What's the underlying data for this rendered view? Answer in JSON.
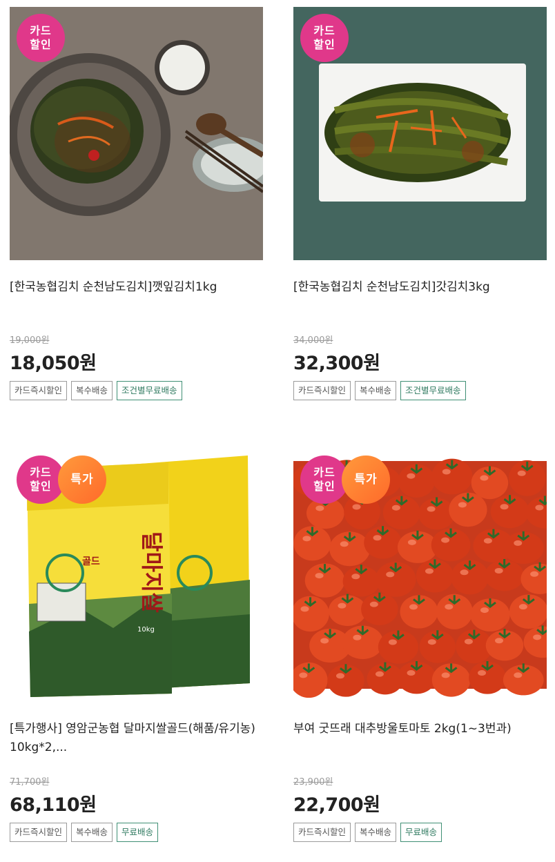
{
  "products": [
    {
      "title": "[한국농협김치 순천남도김치]깻잎김치1kg",
      "orig_price": "19,000원",
      "price": "18,050원",
      "badges": {
        "card": "카드\n할인"
      },
      "tags": [
        "카드즉시할인",
        "복수배송",
        "조건별무료배송"
      ],
      "tag_green_index": 2
    },
    {
      "title": "[한국농협김치 순천남도김치]갓김치3kg",
      "orig_price": "34,000원",
      "price": "32,300원",
      "badges": {
        "card": "카드\n할인"
      },
      "tags": [
        "카드즉시할인",
        "복수배송",
        "조건별무료배송"
      ],
      "tag_green_index": 2
    },
    {
      "title": "[특가행사] 영암군농협 달마지쌀골드(해품/유기농) 10kg*2,...",
      "orig_price": "71,700원",
      "price": "68,110원",
      "badges": {
        "card": "카드\n할인",
        "special": "특가"
      },
      "tags": [
        "카드즉시할인",
        "복수배송",
        "무료배송"
      ],
      "tag_green_index": 2,
      "image_text": {
        "brand": "달마지쌀",
        "sub": "골드",
        "weight": "10kg"
      }
    },
    {
      "title": "부여 굿뜨래 대추방울토마토 2kg(1~3번과)",
      "orig_price": "23,900원",
      "price": "22,700원",
      "badges": {
        "card": "카드\n할인",
        "special": "특가"
      },
      "tags": [
        "카드즉시할인",
        "복수배송",
        "무료배송"
      ],
      "tag_green_index": 2
    }
  ],
  "colors": {
    "card_badge": "#e0388a",
    "special_badge": "#ff7a30",
    "tag_green": "#2f7a60"
  }
}
